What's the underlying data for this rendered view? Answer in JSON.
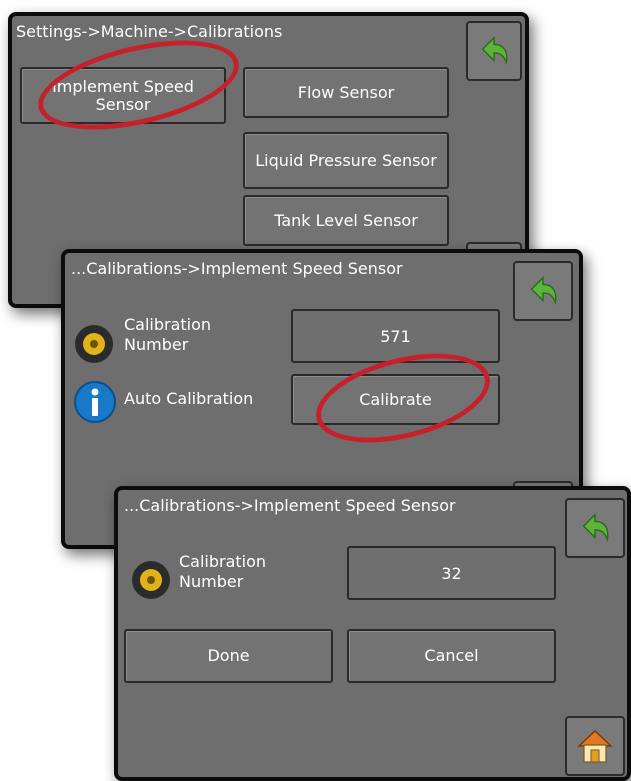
{
  "screen1": {
    "breadcrumb": "Settings->Machine->Calibrations",
    "buttons": {
      "implement_speed_sensor": "Implement Speed Sensor",
      "flow_sensor": "Flow Sensor",
      "liquid_pressure_sensor": "Liquid Pressure Sensor",
      "tank_level_sensor": "Tank Level Sensor"
    },
    "back_icon": "back-arrow-icon"
  },
  "screen2": {
    "breadcrumb": "...Calibrations->Implement Speed Sensor",
    "calibration_number_label": "Calibration Number",
    "calibration_number_value": "571",
    "auto_calibration_label": "Auto Calibration",
    "calibrate_button": "Calibrate",
    "icons": [
      "wheel-sensor-icon",
      "info-icon",
      "back-arrow-icon"
    ]
  },
  "screen3": {
    "breadcrumb": "...Calibrations->Implement Speed Sensor",
    "calibration_number_label": "Calibration Number",
    "calibration_number_value": "32",
    "done_button": "Done",
    "cancel_button": "Cancel",
    "icons": [
      "wheel-sensor-icon",
      "back-arrow-icon",
      "home-icon"
    ]
  },
  "colors": {
    "panel": "#6e6e6e",
    "border": "#0c0c0c",
    "highlight": "#c8202a",
    "back_arrow": "#5cb53a",
    "info": "#1a78c8"
  }
}
